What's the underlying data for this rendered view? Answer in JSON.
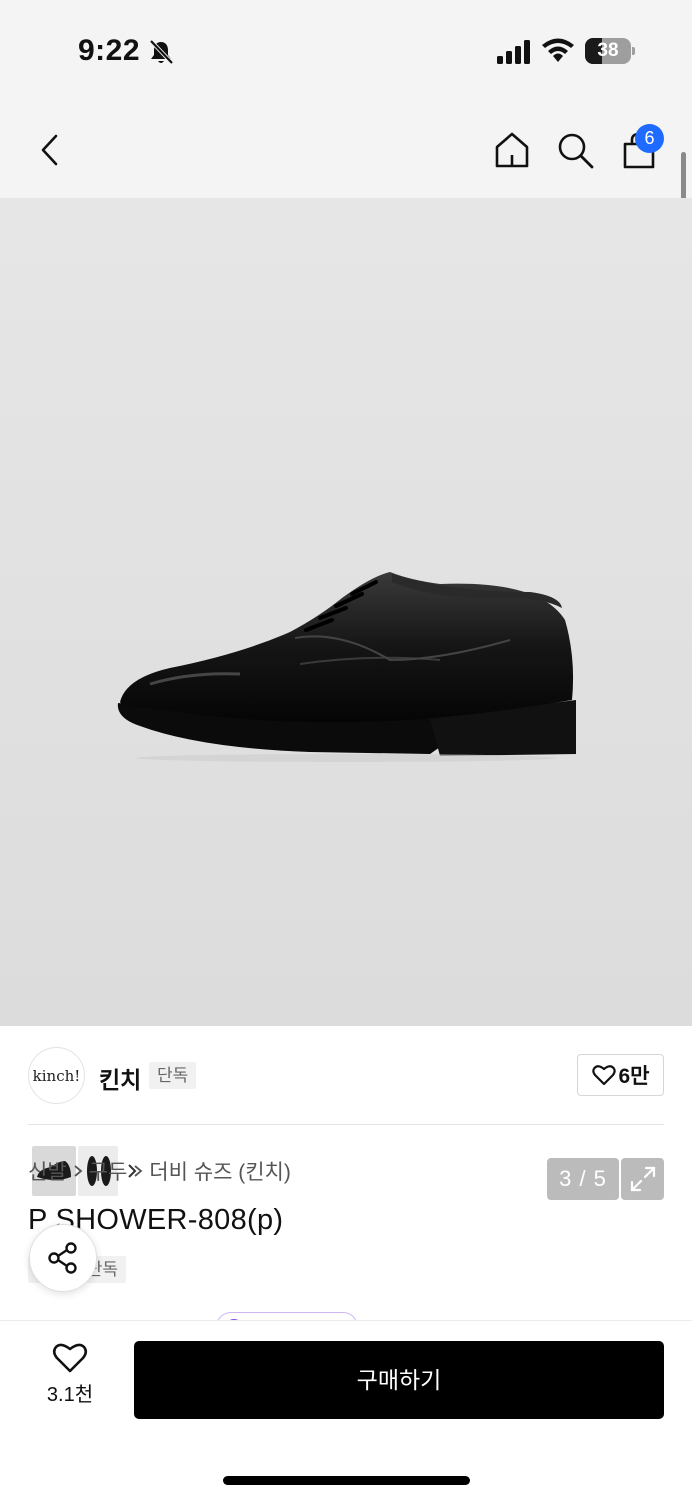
{
  "status": {
    "time": "9:22",
    "battery": "38",
    "battery_level": 0.38
  },
  "nav": {
    "cart_count": "6"
  },
  "gallery": {
    "counter": "3 / 5"
  },
  "brand": {
    "logo_text": "kinch!",
    "name": "킨치",
    "badge": "단독",
    "like_count": "6만"
  },
  "breadcrumb": [
    "신발",
    "구두",
    "더비 슈즈 (킨치)"
  ],
  "product": {
    "title": "P SHOWER-808(p)",
    "tag": "단독"
  },
  "bottom": {
    "wish_count": "3.1천",
    "buy_label": "구매하기"
  },
  "colors": {
    "badge_blue": "#1f6bff",
    "buy_black": "#000000",
    "promo_purple": "#8a4df0"
  },
  "icons": [
    "bell-slash-icon",
    "signal-icon",
    "wifi-icon",
    "back-icon",
    "home-icon",
    "search-icon",
    "shopping-bag-icon",
    "expand-icon",
    "heart-icon",
    "share-icon",
    "chevron-right-icon"
  ]
}
